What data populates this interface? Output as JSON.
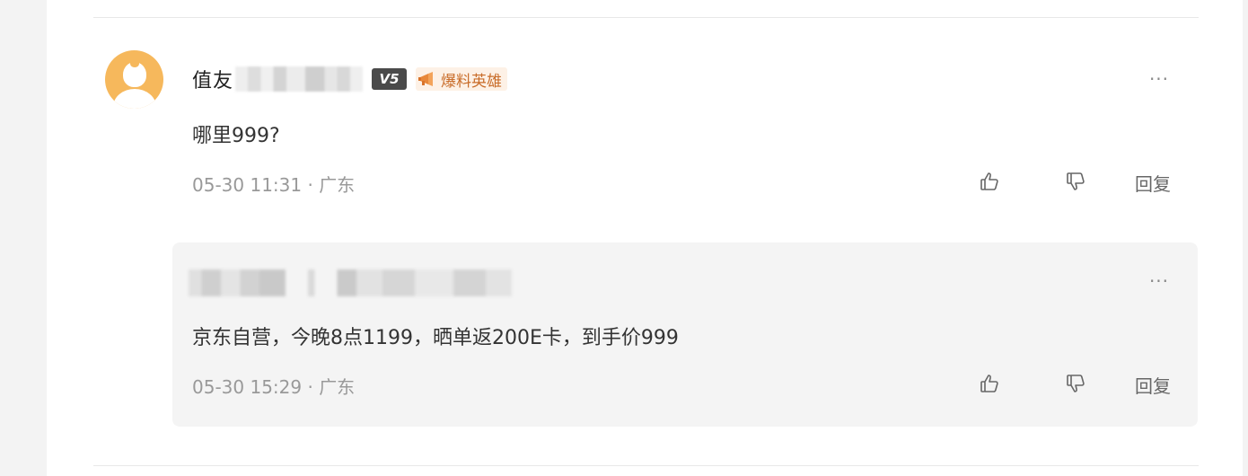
{
  "comment": {
    "username_prefix": "值友",
    "level": "V5",
    "badge": "爆料英雄",
    "text": "哪里999?",
    "timestamp": "05-30 11:31",
    "location": "广东",
    "reply_label": "回复",
    "more_label": "···"
  },
  "reply": {
    "text": "京东自营，今晚8点1199，晒单返200E卡，到手价999",
    "timestamp": "05-30 15:29",
    "location": "广东",
    "reply_label": "回复",
    "more_label": "···"
  },
  "meta_separator": " · ",
  "colors": {
    "avatar": "#f6b85c",
    "badge_text": "#c96d2a",
    "badge_bg": "#fdf1e6",
    "level_bg": "#4a4a4a",
    "reply_bg": "#f4f4f4"
  },
  "icons": {
    "like": "thumbs-up-icon",
    "dislike": "thumbs-down-icon",
    "more": "more-icon",
    "badge": "megaphone-icon"
  }
}
